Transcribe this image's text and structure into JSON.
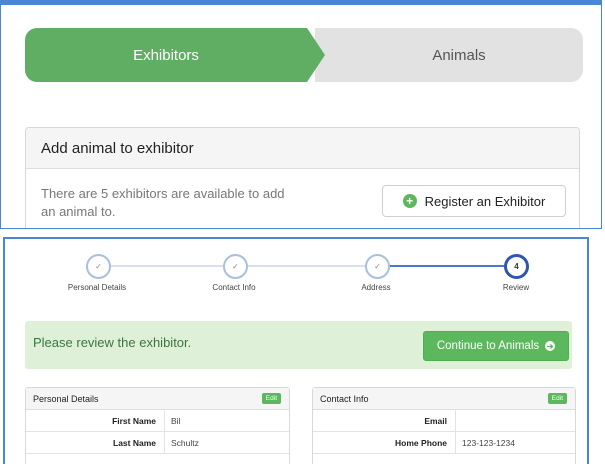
{
  "progress": {
    "steps": [
      {
        "label": "Exhibitors",
        "active": true
      },
      {
        "label": "Animals",
        "active": false
      }
    ]
  },
  "add_animal_card": {
    "title": "Add animal to exhibitor",
    "message": "There are 5 exhibitors are available to add an animal to.",
    "register_button": "Register an Exhibitor"
  },
  "wizard": {
    "steps": [
      {
        "label": "Personal Details",
        "state": "done",
        "mark": "✓"
      },
      {
        "label": "Contact Info",
        "state": "done",
        "mark": "✓"
      },
      {
        "label": "Address",
        "state": "done",
        "mark": "✓"
      },
      {
        "label": "Review",
        "state": "current",
        "mark": "4"
      }
    ]
  },
  "review_alert": {
    "message": "Please review the exhibitor.",
    "continue_button": "Continue to Animals"
  },
  "personal_details": {
    "title": "Personal Details",
    "edit_label": "Edit",
    "rows": [
      {
        "label": "First Name",
        "value": "Bil"
      },
      {
        "label": "Last Name",
        "value": "Schultz"
      }
    ]
  },
  "contact_info": {
    "title": "Contact Info",
    "edit_label": "Edit",
    "rows": [
      {
        "label": "Email",
        "value": ""
      },
      {
        "label": "Home Phone",
        "value": "123-123-1234"
      }
    ]
  },
  "colors": {
    "accent_blue": "#4a86d4",
    "success_green": "#5cb85c",
    "alert_green_bg": "#dff0d8"
  }
}
